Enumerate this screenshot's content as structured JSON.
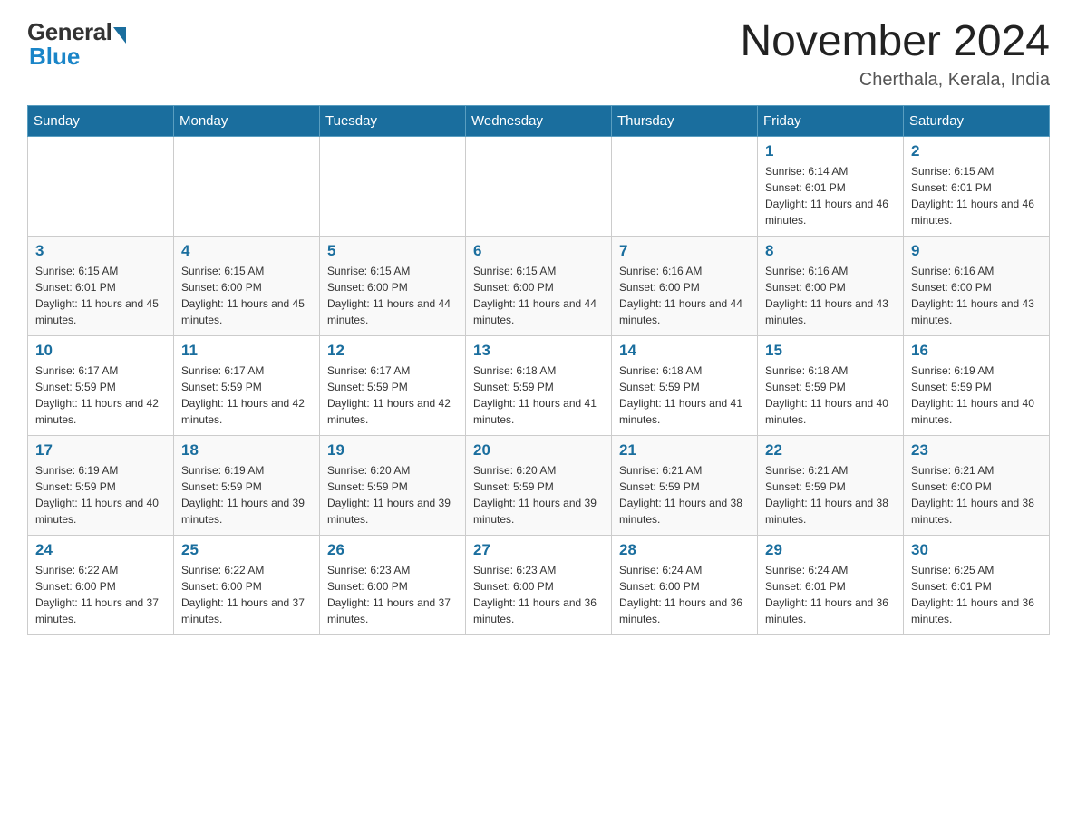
{
  "header": {
    "logo_general": "General",
    "logo_blue": "Blue",
    "month_title": "November 2024",
    "location": "Cherthala, Kerala, India"
  },
  "weekdays": [
    "Sunday",
    "Monday",
    "Tuesday",
    "Wednesday",
    "Thursday",
    "Friday",
    "Saturday"
  ],
  "weeks": [
    [
      {
        "day": "",
        "sunrise": "",
        "sunset": "",
        "daylight": ""
      },
      {
        "day": "",
        "sunrise": "",
        "sunset": "",
        "daylight": ""
      },
      {
        "day": "",
        "sunrise": "",
        "sunset": "",
        "daylight": ""
      },
      {
        "day": "",
        "sunrise": "",
        "sunset": "",
        "daylight": ""
      },
      {
        "day": "",
        "sunrise": "",
        "sunset": "",
        "daylight": ""
      },
      {
        "day": "1",
        "sunrise": "Sunrise: 6:14 AM",
        "sunset": "Sunset: 6:01 PM",
        "daylight": "Daylight: 11 hours and 46 minutes."
      },
      {
        "day": "2",
        "sunrise": "Sunrise: 6:15 AM",
        "sunset": "Sunset: 6:01 PM",
        "daylight": "Daylight: 11 hours and 46 minutes."
      }
    ],
    [
      {
        "day": "3",
        "sunrise": "Sunrise: 6:15 AM",
        "sunset": "Sunset: 6:01 PM",
        "daylight": "Daylight: 11 hours and 45 minutes."
      },
      {
        "day": "4",
        "sunrise": "Sunrise: 6:15 AM",
        "sunset": "Sunset: 6:00 PM",
        "daylight": "Daylight: 11 hours and 45 minutes."
      },
      {
        "day": "5",
        "sunrise": "Sunrise: 6:15 AM",
        "sunset": "Sunset: 6:00 PM",
        "daylight": "Daylight: 11 hours and 44 minutes."
      },
      {
        "day": "6",
        "sunrise": "Sunrise: 6:15 AM",
        "sunset": "Sunset: 6:00 PM",
        "daylight": "Daylight: 11 hours and 44 minutes."
      },
      {
        "day": "7",
        "sunrise": "Sunrise: 6:16 AM",
        "sunset": "Sunset: 6:00 PM",
        "daylight": "Daylight: 11 hours and 44 minutes."
      },
      {
        "day": "8",
        "sunrise": "Sunrise: 6:16 AM",
        "sunset": "Sunset: 6:00 PM",
        "daylight": "Daylight: 11 hours and 43 minutes."
      },
      {
        "day": "9",
        "sunrise": "Sunrise: 6:16 AM",
        "sunset": "Sunset: 6:00 PM",
        "daylight": "Daylight: 11 hours and 43 minutes."
      }
    ],
    [
      {
        "day": "10",
        "sunrise": "Sunrise: 6:17 AM",
        "sunset": "Sunset: 5:59 PM",
        "daylight": "Daylight: 11 hours and 42 minutes."
      },
      {
        "day": "11",
        "sunrise": "Sunrise: 6:17 AM",
        "sunset": "Sunset: 5:59 PM",
        "daylight": "Daylight: 11 hours and 42 minutes."
      },
      {
        "day": "12",
        "sunrise": "Sunrise: 6:17 AM",
        "sunset": "Sunset: 5:59 PM",
        "daylight": "Daylight: 11 hours and 42 minutes."
      },
      {
        "day": "13",
        "sunrise": "Sunrise: 6:18 AM",
        "sunset": "Sunset: 5:59 PM",
        "daylight": "Daylight: 11 hours and 41 minutes."
      },
      {
        "day": "14",
        "sunrise": "Sunrise: 6:18 AM",
        "sunset": "Sunset: 5:59 PM",
        "daylight": "Daylight: 11 hours and 41 minutes."
      },
      {
        "day": "15",
        "sunrise": "Sunrise: 6:18 AM",
        "sunset": "Sunset: 5:59 PM",
        "daylight": "Daylight: 11 hours and 40 minutes."
      },
      {
        "day": "16",
        "sunrise": "Sunrise: 6:19 AM",
        "sunset": "Sunset: 5:59 PM",
        "daylight": "Daylight: 11 hours and 40 minutes."
      }
    ],
    [
      {
        "day": "17",
        "sunrise": "Sunrise: 6:19 AM",
        "sunset": "Sunset: 5:59 PM",
        "daylight": "Daylight: 11 hours and 40 minutes."
      },
      {
        "day": "18",
        "sunrise": "Sunrise: 6:19 AM",
        "sunset": "Sunset: 5:59 PM",
        "daylight": "Daylight: 11 hours and 39 minutes."
      },
      {
        "day": "19",
        "sunrise": "Sunrise: 6:20 AM",
        "sunset": "Sunset: 5:59 PM",
        "daylight": "Daylight: 11 hours and 39 minutes."
      },
      {
        "day": "20",
        "sunrise": "Sunrise: 6:20 AM",
        "sunset": "Sunset: 5:59 PM",
        "daylight": "Daylight: 11 hours and 39 minutes."
      },
      {
        "day": "21",
        "sunrise": "Sunrise: 6:21 AM",
        "sunset": "Sunset: 5:59 PM",
        "daylight": "Daylight: 11 hours and 38 minutes."
      },
      {
        "day": "22",
        "sunrise": "Sunrise: 6:21 AM",
        "sunset": "Sunset: 5:59 PM",
        "daylight": "Daylight: 11 hours and 38 minutes."
      },
      {
        "day": "23",
        "sunrise": "Sunrise: 6:21 AM",
        "sunset": "Sunset: 6:00 PM",
        "daylight": "Daylight: 11 hours and 38 minutes."
      }
    ],
    [
      {
        "day": "24",
        "sunrise": "Sunrise: 6:22 AM",
        "sunset": "Sunset: 6:00 PM",
        "daylight": "Daylight: 11 hours and 37 minutes."
      },
      {
        "day": "25",
        "sunrise": "Sunrise: 6:22 AM",
        "sunset": "Sunset: 6:00 PM",
        "daylight": "Daylight: 11 hours and 37 minutes."
      },
      {
        "day": "26",
        "sunrise": "Sunrise: 6:23 AM",
        "sunset": "Sunset: 6:00 PM",
        "daylight": "Daylight: 11 hours and 37 minutes."
      },
      {
        "day": "27",
        "sunrise": "Sunrise: 6:23 AM",
        "sunset": "Sunset: 6:00 PM",
        "daylight": "Daylight: 11 hours and 36 minutes."
      },
      {
        "day": "28",
        "sunrise": "Sunrise: 6:24 AM",
        "sunset": "Sunset: 6:00 PM",
        "daylight": "Daylight: 11 hours and 36 minutes."
      },
      {
        "day": "29",
        "sunrise": "Sunrise: 6:24 AM",
        "sunset": "Sunset: 6:01 PM",
        "daylight": "Daylight: 11 hours and 36 minutes."
      },
      {
        "day": "30",
        "sunrise": "Sunrise: 6:25 AM",
        "sunset": "Sunset: 6:01 PM",
        "daylight": "Daylight: 11 hours and 36 minutes."
      }
    ]
  ]
}
